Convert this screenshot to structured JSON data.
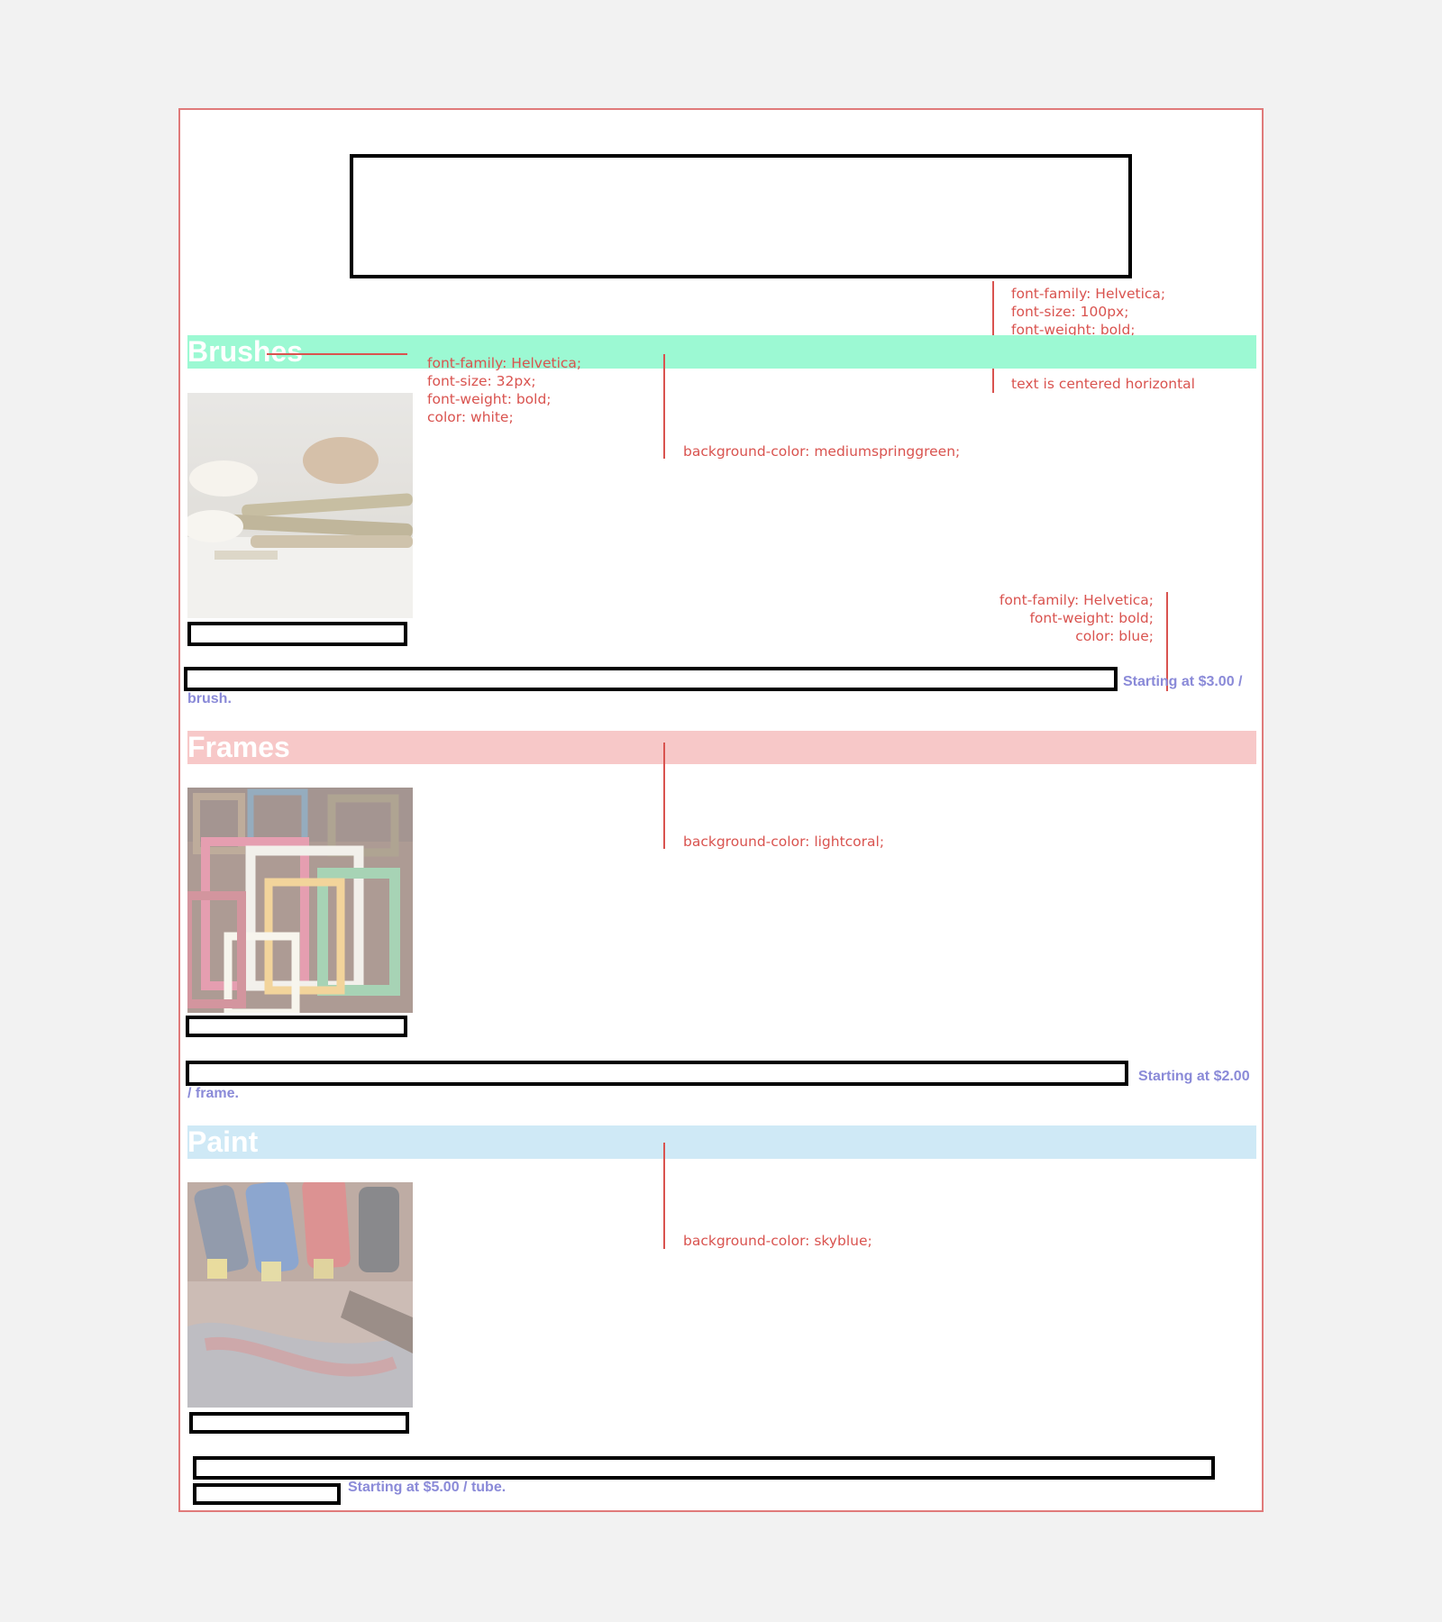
{
  "annotations": {
    "title_style": "font-family: Helvetica;\nfont-size: 100px;\nfont-weight: bold;\ncolor: khaki;",
    "title_centered": "text is centered horizontal",
    "heading_style": "font-family: Helvetica;\nfont-size: 32px;\nfont-weight: bold;\ncolor: white;",
    "price_style": "font-family: Helvetica;\nfont-weight: bold;\ncolor: blue;"
  },
  "sections": [
    {
      "heading": "Brushes",
      "bg_annotation": "background-color: mediumspringgreen;",
      "band_color": "#9cf9d3",
      "price_line1": "Starting at $3.00 /",
      "price_line2": "brush."
    },
    {
      "heading": "Frames",
      "bg_annotation": "background-color: lightcoral;",
      "band_color": "#f7c8c8",
      "price_line1": "Starting at $2.00",
      "price_line2": "/ frame."
    },
    {
      "heading": "Paint",
      "bg_annotation": "background-color: skyblue;",
      "band_color": "#cfe9f6",
      "price_line1": "Starting at $5.00 / tube."
    }
  ],
  "icons": {
    "brushes_photo": "brushes-photo-icon",
    "frames_photo": "frames-photo-icon",
    "paint_photo": "paint-tubes-photo-icon"
  }
}
